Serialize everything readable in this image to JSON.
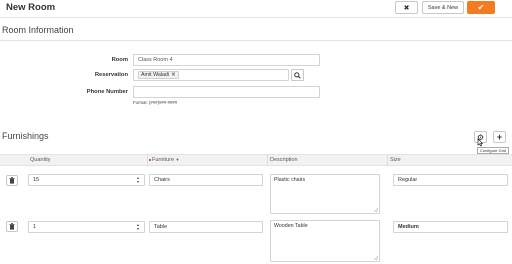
{
  "header": {
    "title": "New Room",
    "close_icon": "close-icon",
    "save_new_label": "Save & New",
    "ok_icon": "check-icon"
  },
  "room_info": {
    "section_title": "Room Information",
    "room_label": "Room",
    "room_value": "Class Room 4",
    "reservation_label": "Reservation",
    "reservation_tag": "Amit Waladi",
    "phone_label": "Phone Number",
    "phone_value": "",
    "phone_hint": "Format: (###)###-####"
  },
  "furnishings": {
    "section_title": "Furnishings",
    "configure_tooltip": "Configure Grid",
    "columns": {
      "quantity": "Quantity",
      "furniture": "Furniture",
      "description": "Description",
      "size": "Size"
    },
    "rows": [
      {
        "quantity": "15",
        "furniture": "Chairs",
        "description": "Plastic chairs",
        "size": "Regular"
      },
      {
        "quantity": "1",
        "furniture": "Table",
        "description": "Wooden Table",
        "size": "Medium"
      }
    ]
  },
  "colors": {
    "accent": "#f47b20",
    "required": "#e02020"
  }
}
